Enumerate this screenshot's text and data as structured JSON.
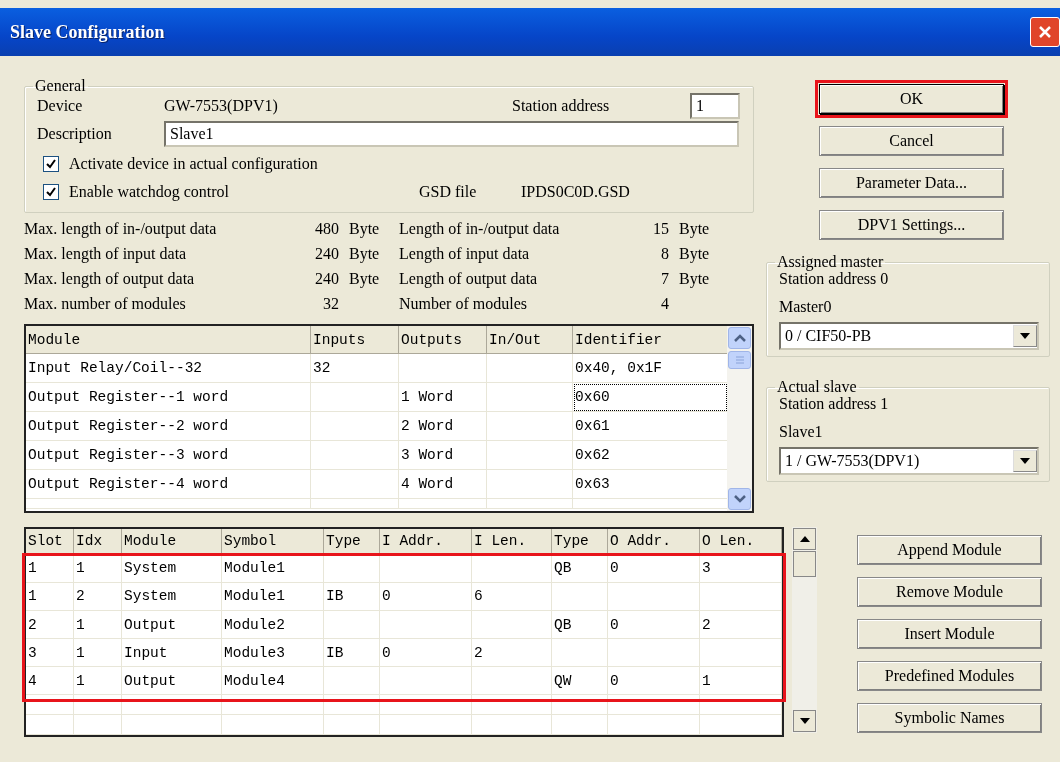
{
  "window": {
    "title": "Slave Configuration"
  },
  "general": {
    "title": "General",
    "device_label": "Device",
    "device": "GW-7553(DPV1)",
    "station_address_label": "Station address",
    "station_address": "1",
    "description_label": "Description",
    "description": "Slave1",
    "checkboxes": [
      {
        "label": "Activate device in actual configuration",
        "checked": true
      },
      {
        "label": "Enable watchdog control",
        "checked": true
      }
    ],
    "gsd_label": "GSD file",
    "gsd_file": "IPDS0C0D.GSD"
  },
  "limits": [
    {
      "label": "Max. length of in-/output data",
      "value": "480",
      "unit": "Byte"
    },
    {
      "label": "Max. length of input data",
      "value": "240",
      "unit": "Byte"
    },
    {
      "label": "Max. length of output data",
      "value": "240",
      "unit": "Byte"
    },
    {
      "label": "Max. number of modules",
      "value": "32"
    }
  ],
  "lengths": [
    {
      "label": "Length of in-/output data",
      "value": "15",
      "unit": "Byte"
    },
    {
      "label": "Length of input data",
      "value": "8",
      "unit": "Byte"
    },
    {
      "label": "Length of output data",
      "value": "7",
      "unit": "Byte"
    },
    {
      "label": "Number of modules",
      "value": "4"
    }
  ],
  "module_catalog": {
    "columns": [
      "Module",
      "Inputs",
      "Outputs",
      "In/Out",
      "Identifier"
    ],
    "rows": [
      {
        "module": "Input Relay/Coil--32",
        "inputs": "32",
        "identifier": "0x40, 0x1F",
        "focused": false
      },
      {
        "module": "Output Register--1 word",
        "outputs": "1 Word",
        "identifier": "0x60",
        "focused": true
      },
      {
        "module": "Output Register--2 word",
        "outputs": "2 Word",
        "identifier": "0x61",
        "focused": false
      },
      {
        "module": "Output Register--3 word",
        "outputs": "3 Word",
        "identifier": "0x62",
        "focused": false
      },
      {
        "module": "Output Register--4 word",
        "outputs": "4 Word",
        "identifier": "0x63",
        "focused": false
      }
    ]
  },
  "buttons": [
    {
      "label": "OK",
      "default": true,
      "highlighted": true
    },
    {
      "label": "Cancel",
      "default": false,
      "highlighted": false
    },
    {
      "label": "Parameter Data...",
      "default": false,
      "highlighted": false
    },
    {
      "label": "DPV1 Settings...",
      "default": false,
      "highlighted": false
    }
  ],
  "assigned_master": {
    "title": "Assigned master",
    "station_address": "Station address 0",
    "name": "Master0",
    "selection": "0 / CIF50-PB"
  },
  "actual_slave": {
    "title": "Actual slave",
    "station_address": "Station address 1",
    "name": "Slave1",
    "selection": "1 / GW-7553(DPV1)"
  },
  "slots": {
    "columns": [
      "Slot",
      "Idx",
      "Module",
      "Symbol",
      "Type",
      "I Addr.",
      "I Len.",
      "Type",
      "O Addr.",
      "O Len."
    ],
    "highlighted": true,
    "rows": [
      {
        "slot": "1",
        "idx": "1",
        "module": "System",
        "symbol": "Module1",
        "o_type": "QB",
        "o_addr": "0",
        "o_len": "3"
      },
      {
        "slot": "1",
        "idx": "2",
        "module": "System",
        "symbol": "Module1",
        "i_type": "IB",
        "i_addr": "0",
        "i_len": "6"
      },
      {
        "slot": "2",
        "idx": "1",
        "module": "Output",
        "symbol": "Module2",
        "o_type": "QB",
        "o_addr": "0",
        "o_len": "2"
      },
      {
        "slot": "3",
        "idx": "1",
        "module": "Input",
        "symbol": "Module3",
        "i_type": "IB",
        "i_addr": "0",
        "i_len": "2"
      },
      {
        "slot": "4",
        "idx": "1",
        "module": "Output",
        "symbol": "Module4",
        "o_type": "QW",
        "o_addr": "0",
        "o_len": "1"
      }
    ]
  },
  "module_buttons": [
    {
      "label": "Append Module"
    },
    {
      "label": "Remove Module"
    },
    {
      "label": "Insert Module"
    },
    {
      "label": "Predefined Modules"
    },
    {
      "label": "Symbolic Names"
    }
  ]
}
